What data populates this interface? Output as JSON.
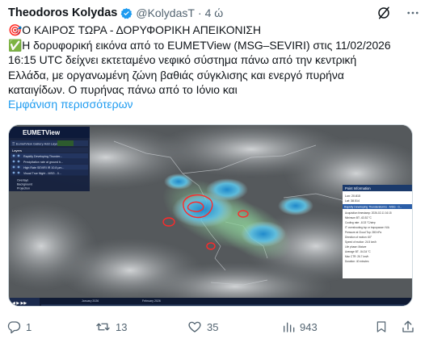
{
  "author": {
    "name": "Theodoros Kolydas",
    "handle": "@KolydasT",
    "separator": "·",
    "time": "4 ώ"
  },
  "tweet": {
    "line1": "🎯Ο ΚΑΙΡΟΣ ΤΩΡΑ - ΔΟΡΥΦΟΡΙΚΗ ΑΠΕΙΚΟΝΙΣΗ",
    "line2": "✅Η δορυφορική εικόνα από το EUMETView (MSG–SEVIRI) στις 11/02/2026",
    "line3": "16:15 UTC δείχνει εκτεταμένο νεφικό σύστημα πάνω από την κεντρική",
    "line4": "Ελλάδα, με οργανωμένη ζώνη βαθιάς σύγκλισης και ενεργό πυρήνα",
    "line5": "καταιγίδων. Ο πυρήνας πάνω από το Ιόνιο και",
    "show_more": "Εμφάνιση περισσότερων"
  },
  "media": {
    "app_title": "EUMETView",
    "layers_title": "Layers",
    "layers": [
      "Rapidly Developing Thunder...",
      "Precipitation rate at ground b...",
      "High Rate SEVIRI IR 10.8 µm...",
      "Visual True Night - MSG - 0..."
    ],
    "panel_sections": [
      "Overlays",
      "Background",
      "Projection"
    ],
    "point_info": {
      "title": "Point Information",
      "lon": "Lon: 20.815",
      "lat": "Lat: 38.514",
      "subtitle": "Rapidly Developing Thunderstorms - MSG - 0...",
      "rows": [
        "Acquisition timestamp: 2026-02-11 16:15",
        "Minimum BT: -63.52 °C",
        "Cooling rate: -8.33 °C/step",
        "IT overshooting top or tropopause: N/A",
        "Pressure at Cloud Top: 280 hPa",
        "Direction of motion: 60°",
        "Speed of motion: 24.5 km/h",
        "Life phase: Mature",
        "Average BT: -54.34 °C",
        "Max CTR: 26.7 km/h",
        "Duration: 40 minutes"
      ]
    },
    "timeline": [
      "January 2026",
      "February 2026"
    ]
  },
  "actions": {
    "replies": "1",
    "retweets": "13",
    "likes": "35",
    "views": "943"
  },
  "colors": {
    "link": "#1d9bf0",
    "muted": "#536471",
    "verified": "#1d9bf0",
    "storm_core": "#ff2a2a"
  },
  "icons": [
    "verified-badge-icon",
    "grok-slash-icon",
    "more-icon",
    "reply-icon",
    "retweet-icon",
    "like-icon",
    "views-icon",
    "bookmark-icon",
    "share-icon"
  ]
}
